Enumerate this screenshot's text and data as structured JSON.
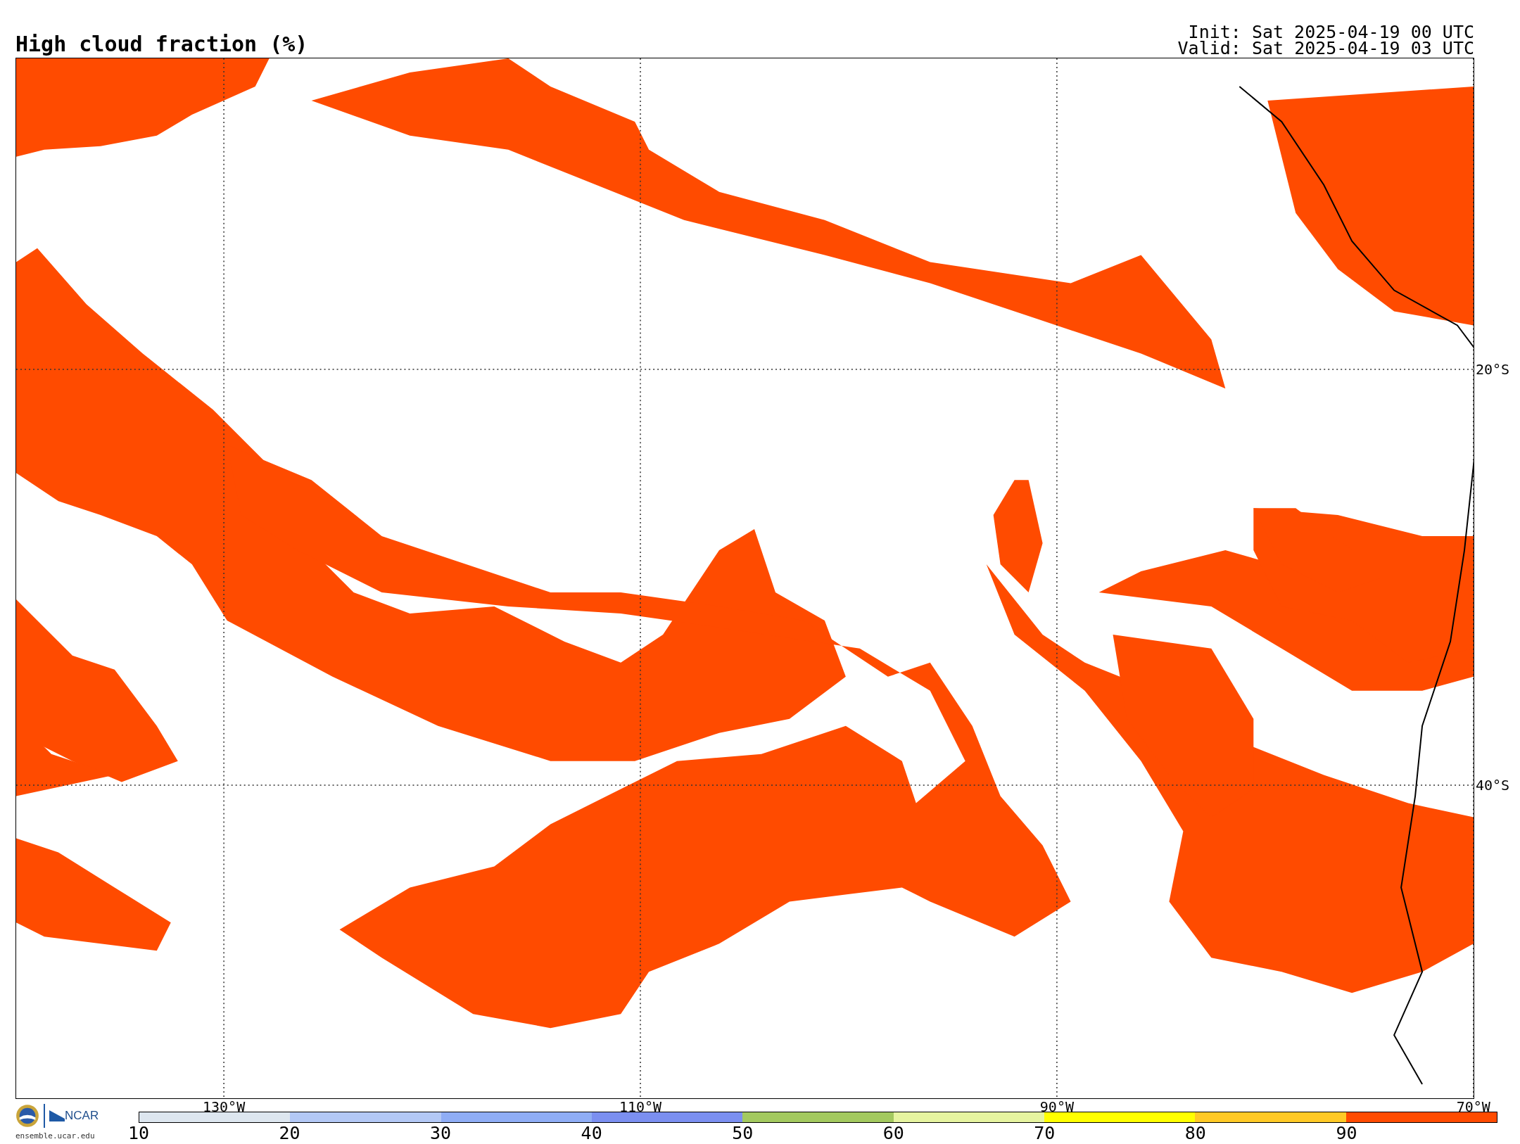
{
  "title": "High cloud fraction (%)",
  "init": "Init: Sat 2025-04-19 00 UTC",
  "valid": "Valid: Sat 2025-04-19 03 UTC",
  "map": {
    "longitude_labels": [
      "130°W",
      "110°W",
      "90°W",
      "70°W"
    ],
    "latitude_labels": [
      "20°S",
      "40°S"
    ]
  },
  "logo": {
    "wordmark": "NCAR",
    "url": "ensemble.ucar.edu"
  },
  "colorbar": {
    "bins": [
      {
        "color": "#dde6ef"
      },
      {
        "color": "#b3c8f5"
      },
      {
        "color": "#8fadf5"
      },
      {
        "color": "#7b8ff0"
      },
      {
        "color": "#a3c95f"
      },
      {
        "color": "#e6f4a0"
      },
      {
        "color": "#ffff00"
      },
      {
        "color": "#ffc926"
      },
      {
        "color": "#ff4b00"
      }
    ],
    "ticks": [
      "10",
      "20",
      "30",
      "40",
      "50",
      "60",
      "70",
      "80",
      "90"
    ]
  }
}
